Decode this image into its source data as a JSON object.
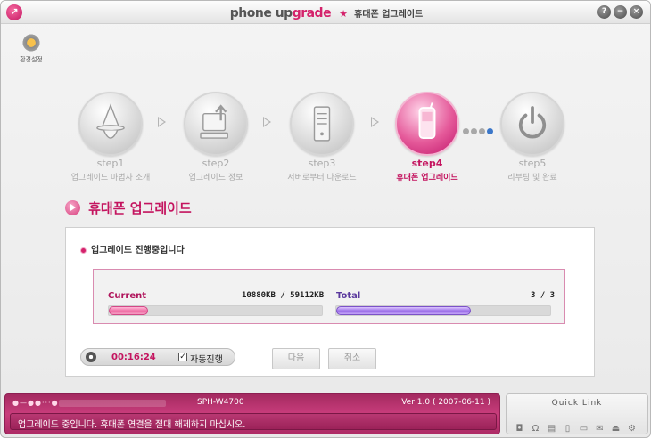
{
  "titlebar": {
    "brand_a": "phone up",
    "brand_b": "grade",
    "star": "★",
    "subtitle": "휴대폰 업그레이드",
    "help_label": "?",
    "min_label": "−",
    "close_label": "×"
  },
  "settings": {
    "label": "환경설정"
  },
  "steps": [
    {
      "name": "step1",
      "desc": "업그레이드 마법사 소개",
      "icon": "wizard-icon",
      "active": false
    },
    {
      "name": "step2",
      "desc": "업그레이드 정보",
      "icon": "computer-icon",
      "active": false
    },
    {
      "name": "step3",
      "desc": "서버로부터 다운로드",
      "icon": "server-icon",
      "active": false
    },
    {
      "name": "step4",
      "desc": "휴대폰 업그레이드",
      "icon": "phone-icon",
      "active": true
    },
    {
      "name": "step5",
      "desc": "리부팅 및 완료",
      "icon": "power-icon",
      "active": false
    }
  ],
  "section": {
    "title": "휴대폰 업그레이드"
  },
  "panel": {
    "heading": "업그레이드 진행중입니다",
    "current": {
      "label": "Current",
      "value": "10880KB / 59112KB",
      "fraction": 0.184
    },
    "total": {
      "label": "Total",
      "value": "3 / 3",
      "fraction": 0.63
    },
    "timer": "00:16:24",
    "auto_label": "자동진행",
    "auto_checked": true,
    "next_button": "다음",
    "cancel_button": "취소"
  },
  "status": {
    "model": "SPH-W4700",
    "version": "Ver 1.0 ( 2007-06-11 )",
    "message": "업그레이드 중입니다. 휴대폰 연결을 절대 해제하지 마십시오."
  },
  "quicklink": {
    "title": "Quick Link",
    "icons": [
      "camera-icon",
      "headset-icon",
      "document-icon",
      "phone-icon",
      "folder-icon",
      "mail-icon",
      "eject-icon",
      "settings-icon"
    ]
  },
  "colors": {
    "accent": "#c4145f",
    "total_bar": "#9c6fe8",
    "current_bar": "#ef6fa6",
    "status_bg": "#c93d7c"
  }
}
